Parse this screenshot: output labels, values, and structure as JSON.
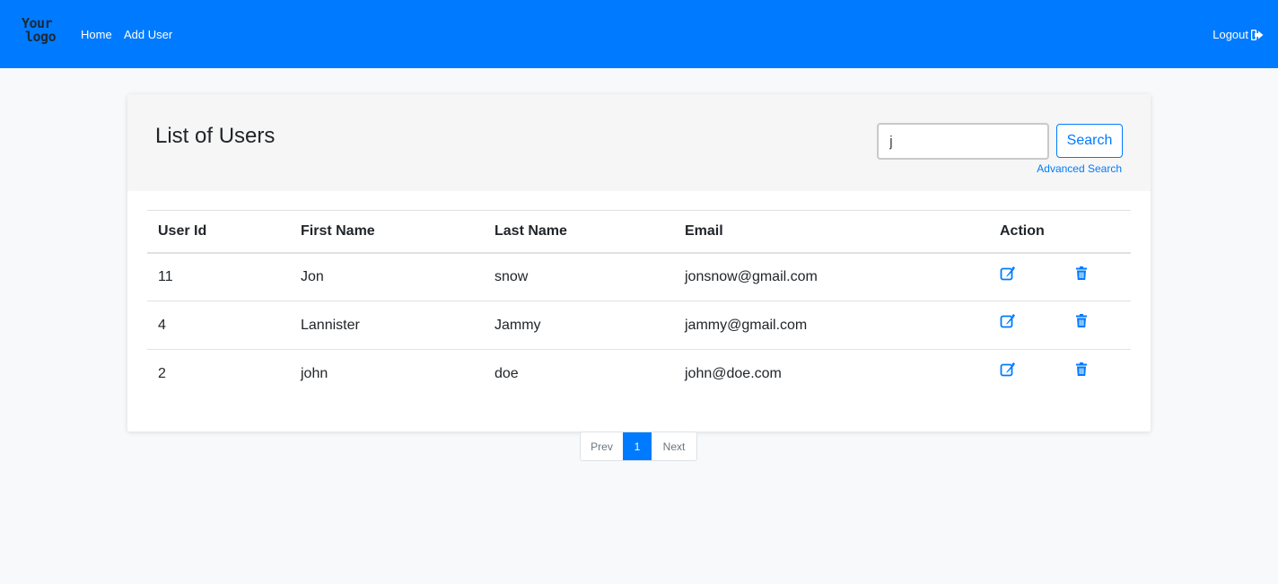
{
  "navbar": {
    "logo_line1": "Your",
    "logo_line2": "logo",
    "home": "Home",
    "add_user": "Add User",
    "logout": "Logout",
    "background": "#007bff"
  },
  "header": {
    "title": "List of Users",
    "search": {
      "value": "j",
      "button_label": "Search",
      "advanced_label": "Advanced Search"
    }
  },
  "table": {
    "columns": [
      "User Id",
      "First Name",
      "Last Name",
      "Email",
      "Action"
    ],
    "rows": [
      {
        "id": "11",
        "first": "Jon",
        "last": "snow",
        "email": "jonsnow@gmail.com"
      },
      {
        "id": "4",
        "first": "Lannister",
        "last": "Jammy",
        "email": "jammy@gmail.com"
      },
      {
        "id": "2",
        "first": "john",
        "last": "doe",
        "email": "john@doe.com"
      }
    ],
    "action_icons": [
      "edit-icon",
      "trash-icon"
    ]
  },
  "pagination": {
    "prev": "Prev",
    "current": "1",
    "next": "Next"
  },
  "colors": {
    "accent": "#007bff",
    "page_background": "#f8f9fa"
  }
}
